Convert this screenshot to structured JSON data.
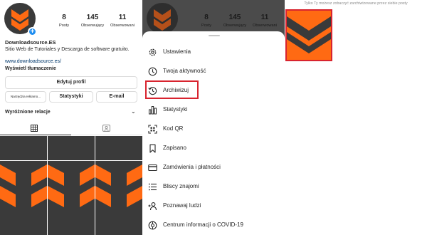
{
  "profile": {
    "username_display": "Downloadsource.ES",
    "bio": "Sitio Web de Tutoriales y Descarga de software gratuito.",
    "link": "www.downloadsource.es/",
    "translate": "Wyświetl tłumaczenie",
    "stats": [
      {
        "value": "8",
        "label": "Posty"
      },
      {
        "value": "145",
        "label": "Obserwujący"
      },
      {
        "value": "11",
        "label": "Obserwowani"
      }
    ],
    "buttons": {
      "edit": "Edytuj profil",
      "tools": "Narzędzia reklamo...",
      "stats": "Statystyki",
      "email": "E-mail"
    },
    "highlights": "Wyróżnione relacje"
  },
  "menu_panel": {
    "stats": [
      {
        "value": "8",
        "label": "Posty"
      },
      {
        "value": "145",
        "label": "Obserwujący"
      },
      {
        "value": "11",
        "label": "Obserwowani"
      }
    ],
    "items": [
      {
        "label": "Ustawienia",
        "icon": "gear-icon"
      },
      {
        "label": "Twoja aktywność",
        "icon": "activity-icon"
      },
      {
        "label": "Archiwizuj",
        "icon": "archive-icon",
        "highlighted": true
      },
      {
        "label": "Statystyki",
        "icon": "bar-chart-icon"
      },
      {
        "label": "Kod QR",
        "icon": "qr-code-icon"
      },
      {
        "label": "Zapisano",
        "icon": "bookmark-icon"
      },
      {
        "label": "Zamówienia i płatności",
        "icon": "card-icon"
      },
      {
        "label": "Bliscy znajomi",
        "icon": "close-friends-icon"
      },
      {
        "label": "Poznawaj ludzi",
        "icon": "add-person-icon"
      },
      {
        "label": "Centrum informacji o COVID-19",
        "icon": "covid-info-icon"
      }
    ]
  },
  "archive_panel": {
    "notice": "Tylko Ty możesz zobaczyć zarchiwizowane przez siebie posty"
  },
  "colors": {
    "brand_orange": "#ff6a13",
    "dark_grey": "#3a3a3a",
    "highlight_red": "#d8242f",
    "link_blue": "#00376b",
    "badge_blue": "#1f8ef1"
  }
}
